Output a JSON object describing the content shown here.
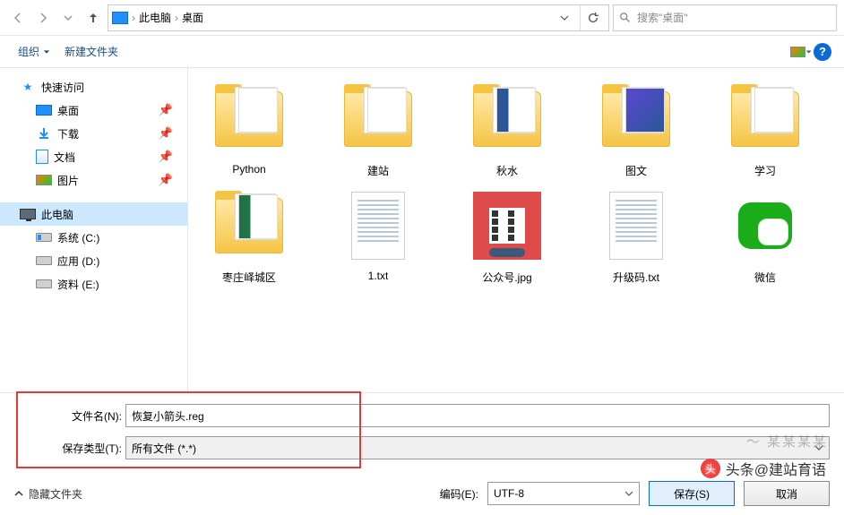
{
  "nav": {
    "path_root": "此电脑",
    "path_leaf": "桌面",
    "search_placeholder": "搜索\"桌面\""
  },
  "cmdbar": {
    "organize": "组织",
    "new_folder": "新建文件夹"
  },
  "sidebar": {
    "quick_access": "快速访问",
    "items": [
      {
        "icon": "desk",
        "label": "桌面",
        "pinned": true
      },
      {
        "icon": "dl",
        "label": "下载",
        "pinned": true
      },
      {
        "icon": "doc",
        "label": "文档",
        "pinned": true
      },
      {
        "icon": "pic",
        "label": "图片",
        "pinned": true
      }
    ],
    "this_pc": "此电脑",
    "drives": [
      {
        "label": "系统 (C:)",
        "cls": "c"
      },
      {
        "label": "应用 (D:)",
        "cls": ""
      },
      {
        "label": "资料 (E:)",
        "cls": ""
      }
    ]
  },
  "files": [
    {
      "type": "folder",
      "peek": "",
      "label": "Python"
    },
    {
      "type": "folder",
      "peek": "",
      "label": "建站"
    },
    {
      "type": "folder",
      "peek": "word",
      "label": "秋水"
    },
    {
      "type": "folder",
      "peek": "pic2",
      "label": "图文"
    },
    {
      "type": "folder",
      "peek": "",
      "label": "学习"
    },
    {
      "type": "folder",
      "peek": "excel",
      "label": "枣庄峄城区"
    },
    {
      "type": "txt",
      "label": "1.txt"
    },
    {
      "type": "jpg",
      "label": "公众号.jpg"
    },
    {
      "type": "txt",
      "label": "升级码.txt"
    },
    {
      "type": "wechat",
      "label": "微信"
    }
  ],
  "save": {
    "filename_label": "文件名(N):",
    "filename_value": "恢复小箭头.reg",
    "type_label": "保存类型(T):",
    "type_value": "所有文件 (*.*)"
  },
  "bottom": {
    "hide_folders": "隐藏文件夹",
    "encoding_label": "编码(E):",
    "encoding_value": "UTF-8",
    "save_btn": "保存(S)",
    "cancel_btn": "取消"
  },
  "watermark": "头条@建站育语"
}
